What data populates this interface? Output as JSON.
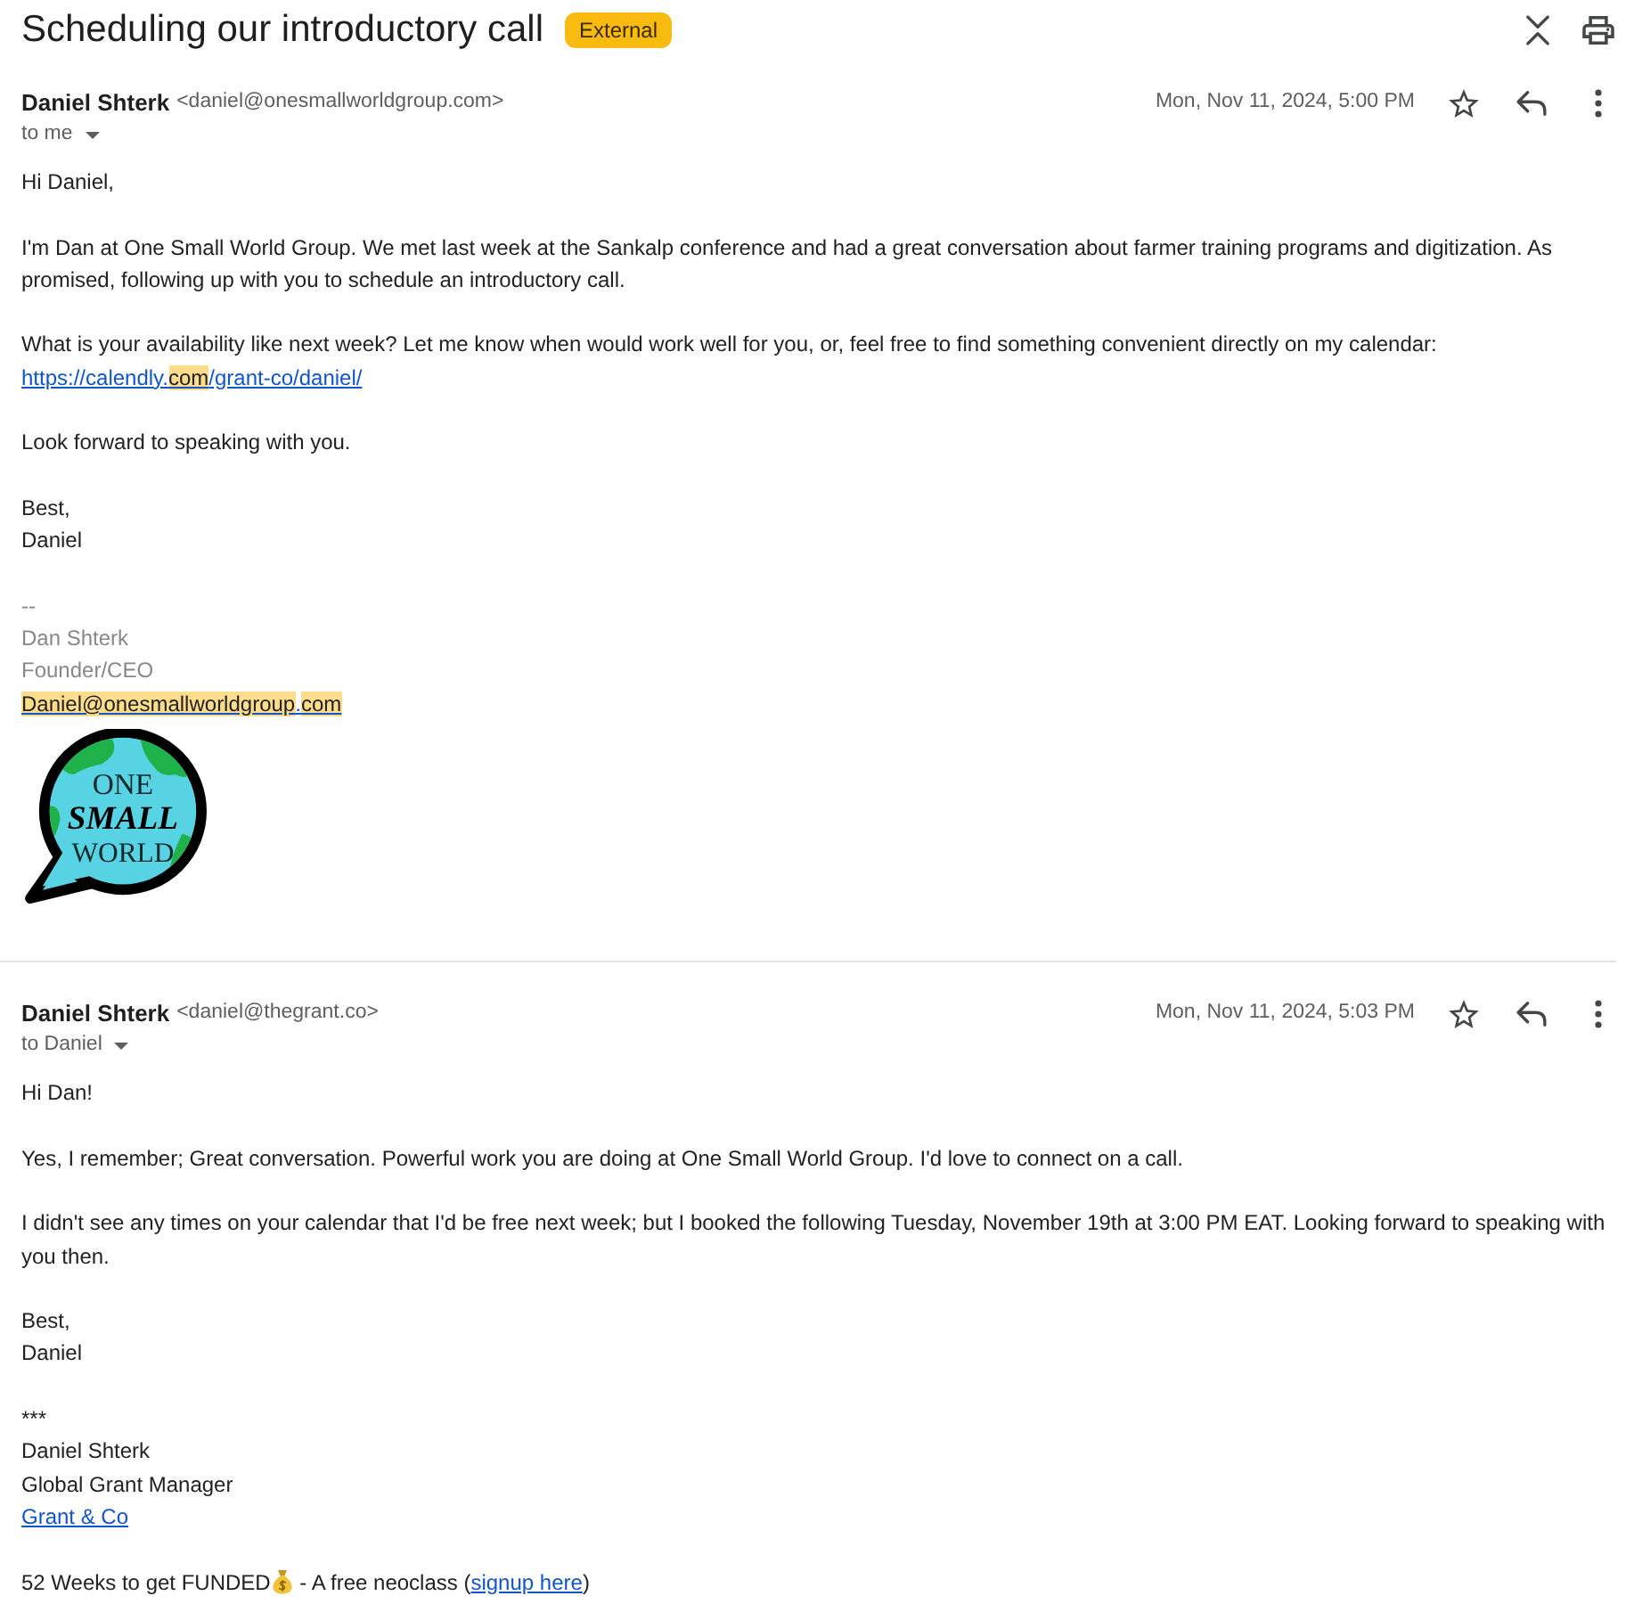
{
  "subject": "Scheduling our introductory call",
  "label": "External",
  "messages": [
    {
      "sender_name": "Daniel Shterk",
      "sender_email": "<daniel@onesmallworldgroup.com>",
      "recipients": "to me",
      "date": "Mon, Nov 11, 2024, 5:00 PM",
      "starred": false,
      "body": [
        {
          "kind": "paragraph",
          "muted": false,
          "lines": [
            [
              {
                "kind": "text",
                "text": "Hi Daniel,"
              }
            ]
          ]
        },
        {
          "kind": "paragraph",
          "muted": false,
          "lines": [
            [
              {
                "kind": "text",
                "text": "I'm Dan at One Small World Group. We met last week at the Sankalp conference and had a great conversation about farmer training programs and digitization. As promised, following up with you to schedule an introductory call."
              }
            ]
          ]
        },
        {
          "kind": "paragraph",
          "muted": false,
          "lines": [
            [
              {
                "kind": "text",
                "text": "What is your availability like next week? Let me know when would work well for you, or, feel free to find something convenient directly on my calendar: "
              },
              {
                "kind": "link",
                "segments": [
                  {
                    "text": "https://calendly.",
                    "highlighted": false
                  },
                  {
                    "text": "com",
                    "highlighted": true
                  },
                  {
                    "text": "/grant-co/daniel/",
                    "highlighted": false
                  }
                ]
              }
            ]
          ]
        },
        {
          "kind": "paragraph",
          "muted": false,
          "lines": [
            [
              {
                "kind": "text",
                "text": "Look forward to speaking with you."
              }
            ]
          ]
        },
        {
          "kind": "paragraph",
          "muted": false,
          "lines": [
            [
              {
                "kind": "text",
                "text": "Best,"
              }
            ],
            [
              {
                "kind": "text",
                "text": "Daniel"
              }
            ]
          ]
        },
        {
          "kind": "paragraph",
          "muted": true,
          "lines": [
            [
              {
                "kind": "text",
                "text": "--"
              }
            ],
            [
              {
                "kind": "text",
                "text": "Dan Shterk"
              }
            ],
            [
              {
                "kind": "text",
                "text": "Founder/CEO"
              }
            ],
            [
              {
                "kind": "link",
                "segments": [
                  {
                    "text": "Daniel@onesmallworldgroup",
                    "highlighted": true
                  },
                  {
                    "text": ".",
                    "highlighted": false
                  },
                  {
                    "text": "com",
                    "highlighted": true
                  }
                ]
              }
            ]
          ]
        },
        {
          "kind": "logo",
          "words": [
            "ONE",
            "SMALL",
            "WORLD"
          ]
        }
      ]
    },
    {
      "sender_name": "Daniel Shterk",
      "sender_email": "<daniel@thegrant.co>",
      "recipients": "to Daniel",
      "date": "Mon, Nov 11, 2024, 5:03 PM",
      "starred": false,
      "body": [
        {
          "kind": "paragraph",
          "muted": false,
          "lines": [
            [
              {
                "kind": "text",
                "text": "Hi Dan!"
              }
            ]
          ]
        },
        {
          "kind": "paragraph",
          "muted": false,
          "lines": [
            [
              {
                "kind": "text",
                "text": "Yes, I remember; Great conversation. Powerful work you are doing at One Small World Group. I'd love to connect on a call."
              }
            ]
          ]
        },
        {
          "kind": "paragraph",
          "muted": false,
          "lines": [
            [
              {
                "kind": "text",
                "text": "I didn't see any times on your calendar that I'd be free next week; but I booked the following Tuesday, November 19th at 3:00 PM EAT. Looking forward to speaking with you then."
              }
            ]
          ]
        },
        {
          "kind": "paragraph",
          "muted": false,
          "lines": [
            [
              {
                "kind": "text",
                "text": "Best,"
              }
            ],
            [
              {
                "kind": "text",
                "text": "Daniel"
              }
            ]
          ]
        },
        {
          "kind": "paragraph",
          "muted": false,
          "lines": [
            [
              {
                "kind": "text",
                "text": "***"
              }
            ],
            [
              {
                "kind": "text",
                "text": "Daniel Shterk"
              }
            ],
            [
              {
                "kind": "text",
                "text": "Global Grant Manager"
              }
            ],
            [
              {
                "kind": "link",
                "segments": [
                  {
                    "text": "Grant & Co",
                    "highlighted": false
                  }
                ]
              }
            ]
          ]
        },
        {
          "kind": "paragraph",
          "muted": false,
          "lines": [
            [
              {
                "kind": "text",
                "text": "52 Weeks to get FUNDED"
              },
              {
                "kind": "icon"
              },
              {
                "kind": "text",
                "text": " - A free neoclass ("
              },
              {
                "kind": "link",
                "segments": [
                  {
                    "text": "signup here",
                    "highlighted": false
                  }
                ]
              },
              {
                "kind": "text",
                "text": ")"
              }
            ]
          ]
        }
      ]
    }
  ]
}
